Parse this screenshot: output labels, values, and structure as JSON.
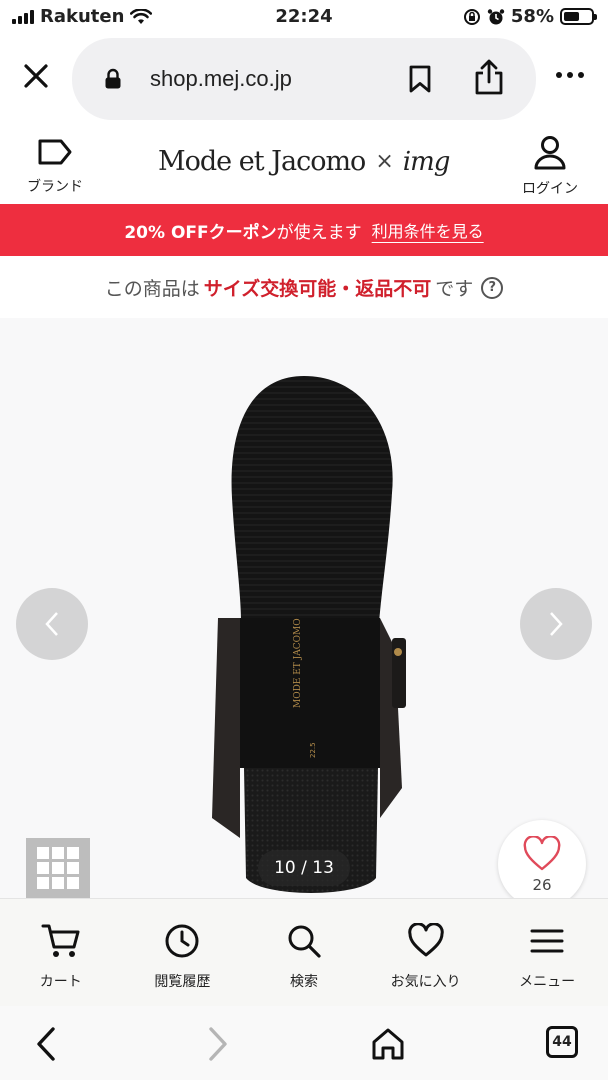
{
  "status_bar": {
    "carrier": "Rakuten",
    "time": "22:24",
    "battery": "58%",
    "battery_level": 0.58
  },
  "browser": {
    "url": "shop.mej.co.jp",
    "tab_count": "44"
  },
  "site_header": {
    "brand_label": "ブランド",
    "logo_main": "Mode et Jacomo",
    "logo_cross": "×",
    "logo_sub": "img",
    "login_label": "ログイン"
  },
  "coupon": {
    "text_strong": "20% OFFクーポン",
    "text_rest": "が使えます",
    "link": "利用条件を見る",
    "bg_color": "#ee2e3f"
  },
  "policy": {
    "prefix": "この商品は",
    "emphasis": "サイズ交換可能・返品不可",
    "suffix": "です",
    "help_icon": "?"
  },
  "product": {
    "image_counter": "10 / 13",
    "favorite_count": "26",
    "sole_brand": "MODE ET JACOMO",
    "sole_size": "22.5"
  },
  "app_nav": [
    {
      "label": "カート",
      "icon": "cart-icon"
    },
    {
      "label": "閲覧履歴",
      "icon": "clock-icon"
    },
    {
      "label": "検索",
      "icon": "search-icon"
    },
    {
      "label": "お気に入り",
      "icon": "heart-icon"
    },
    {
      "label": "メニュー",
      "icon": "menu-icon"
    }
  ]
}
